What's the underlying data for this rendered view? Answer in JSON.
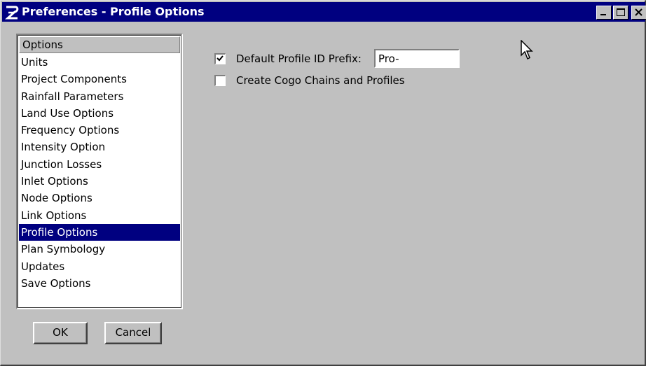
{
  "window": {
    "title": "Preferences - Profile Options",
    "app_icon": "geopak-logo-icon",
    "controls": [
      "minimize-icon",
      "maximize-icon",
      "close-icon"
    ]
  },
  "options_list": {
    "header": "Options",
    "selected_index": 11,
    "items": [
      {
        "label": "Units"
      },
      {
        "label": "Project Components"
      },
      {
        "label": "Rainfall Parameters"
      },
      {
        "label": "Land Use Options"
      },
      {
        "label": "Frequency Options"
      },
      {
        "label": "Intensity Option"
      },
      {
        "label": "Junction Losses"
      },
      {
        "label": "Inlet Options"
      },
      {
        "label": "Node Options"
      },
      {
        "label": "Link Options"
      },
      {
        "label": "Profile Options"
      },
      {
        "label": "Plan Symbology"
      },
      {
        "label": "Updates"
      },
      {
        "label": "Save Options"
      }
    ]
  },
  "buttons": {
    "ok": "OK",
    "cancel": "Cancel"
  },
  "profile_options": {
    "default_prefix": {
      "label": "Default Profile ID Prefix:",
      "checked": true,
      "value": "Pro-"
    },
    "cogo": {
      "label": "Create Cogo Chains and Profiles",
      "checked": false
    }
  },
  "colors": {
    "titlebar": "#000080",
    "selection": "#000080",
    "face": "#c0c0c0"
  }
}
